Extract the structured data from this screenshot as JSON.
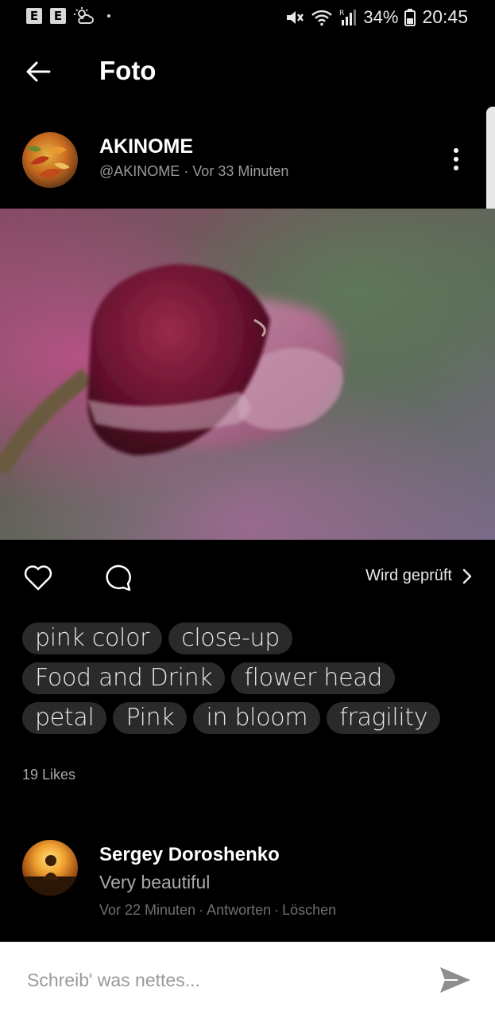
{
  "status_bar": {
    "left_badges": [
      "E",
      "E"
    ],
    "battery_percent": "34%",
    "time": "20:45",
    "icons": [
      "mute-icon",
      "wifi-icon",
      "signal-icon",
      "battery-icon"
    ]
  },
  "header": {
    "title": "Foto",
    "back_icon": "arrow-left-icon"
  },
  "post": {
    "author_name": "AKINOME",
    "author_handle": "@AKINOME",
    "separator": " · ",
    "posted_time": "Vor 33 Minuten",
    "more_icon": "vertical-dots-icon",
    "photo_subject": "pink flower bud close-up"
  },
  "actions": {
    "like_icon": "heart-outline-icon",
    "comment_icon": "speech-bubble-icon",
    "review_label": "Wird geprüft",
    "review_icon": "chevron-right-icon"
  },
  "tags": [
    "pink color",
    "close-up",
    "Food and Drink",
    "flower head",
    "petal",
    "Pink",
    "in bloom",
    "fragility"
  ],
  "likes_label": "19 Likes",
  "comments": [
    {
      "author": "Sergey Doroshenko",
      "text": "Very beautiful",
      "time": "Vor 22 Minuten",
      "reply_label": "Antworten",
      "delete_label": "Löschen"
    }
  ],
  "composer": {
    "placeholder": "Schreib' was nettes...",
    "send_icon": "send-arrow-icon"
  },
  "colors": {
    "background": "#000000",
    "tag_background": "#2a2a2a",
    "composer_background": "#ffffff"
  }
}
